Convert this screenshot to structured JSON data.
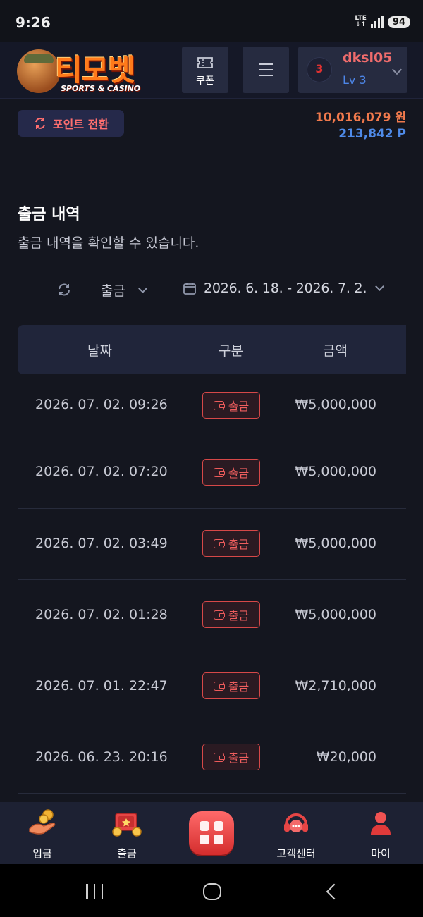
{
  "status_bar": {
    "time": "9:26",
    "network": "LTE",
    "battery": "94"
  },
  "header": {
    "logo_text": "티모벳",
    "logo_sub": "SPORTS & CASINO",
    "coupon_label": "쿠폰",
    "user": {
      "name": "dksl05",
      "level": "Lv 3",
      "avatar_text": "3"
    }
  },
  "point_convert_label": "포인트 전환",
  "balance": {
    "won": "10,016,079 원",
    "point": "213,842 P"
  },
  "page": {
    "title": "출금 내역",
    "description": "출금 내역을 확인할 수 있습니다."
  },
  "filters": {
    "type_selected": "출금",
    "date_range": "2026. 6. 18. - 2026. 7. 2."
  },
  "table": {
    "headers": {
      "date": "날짜",
      "type": "구분",
      "amount": "금액"
    },
    "rows": [
      {
        "date": "2026. 07. 02. 09:26",
        "type": "출금",
        "amount": "₩5,000,000"
      },
      {
        "date": "2026. 07. 02. 07:20",
        "type": "출금",
        "amount": "₩5,000,000"
      },
      {
        "date": "2026. 07. 02. 03:49",
        "type": "출금",
        "amount": "₩5,000,000"
      },
      {
        "date": "2026. 07. 02. 01:28",
        "type": "출금",
        "amount": "₩5,000,000"
      },
      {
        "date": "2026. 07. 01. 22:47",
        "type": "출금",
        "amount": "₩2,710,000"
      },
      {
        "date": "2026. 06. 23. 20:16",
        "type": "출금",
        "amount": "₩20,000"
      }
    ]
  },
  "bottom_nav": {
    "deposit": "입금",
    "withdraw": "출금",
    "support": "고객센터",
    "my": "마이"
  },
  "colors": {
    "accent_red": "#ef5e5e",
    "point_blue": "#4f8be9",
    "won_orange": "#f0794c",
    "background": "#14161f"
  }
}
